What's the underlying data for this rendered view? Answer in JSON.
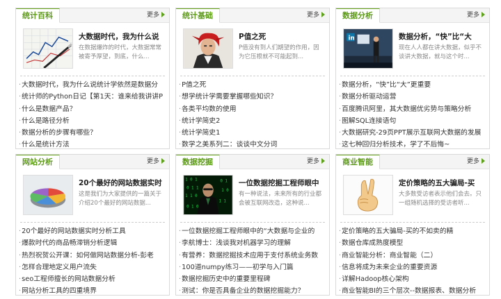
{
  "panels": [
    {
      "tab": "统计百科",
      "more": "更多",
      "feature": {
        "title": "大数据时代，我为什么说",
        "desc": "在数据爆炸的时代，大数据常常被寄予厚望，到底，什么..."
      },
      "links": [
        "大数据时代，我为什么说统计学依然是数据分",
        "统计师的Python日记【第1天：谁来给我讲讲P",
        "什么是数据产品？",
        "什么是路径分析",
        "数据分析的步骤有哪些？",
        "什么是统计方法"
      ]
    },
    {
      "tab": "统计基础",
      "more": "更多",
      "feature": {
        "title": "P值之死",
        "desc": "P值没有到人们期望的作用，因为它压根就不可能起到..."
      },
      "links": [
        "P值之死",
        "想学统计学需要掌握哪些知识？",
        "各类平均数的使用",
        "统计学简史2",
        "统计学简史1",
        "数学之美系列二：谈谈中文分词"
      ]
    },
    {
      "tab": "数据分析",
      "more": "更多",
      "feature": {
        "title": "数据分析，“快”比“大",
        "desc": "现在人人都在讲大数据，似乎不谈讲大数据，就与这个时..."
      },
      "links": [
        "数据分析，“快”比“大”更重要",
        "数据分析驱动运营",
        "百度腾讯阿里，其大数据优劣势与策略分析",
        "图解SQL连接语句",
        "大数据研究-29页PPT展示互联网大数据的发展",
        "这七种回归分析技术，学了不后悔~"
      ]
    },
    {
      "tab": "网站分析",
      "more": "更多",
      "feature": {
        "title": "20个最好的网站数据实时",
        "desc": "这是我们为大家提供的一篇关于介绍20个最好的网站数据..."
      },
      "links": [
        "20个最好的网站数据实时分析工具",
        "爆款时代的商品畅滞销分析逻辑",
        "热烈祝贺公开课：如何做网站数据分析-彭老",
        "怎样合理地定义用户流失",
        "seo工程师擅长的网站数据分析",
        "网站分析工具的四重境界"
      ]
    },
    {
      "tab": "数据挖掘",
      "more": "更多",
      "feature": {
        "title": "一位数据挖掘工程师眼中",
        "desc": "有一种说法，未来所有的行业都会被互联网改造，这种说..."
      },
      "links": [
        "一位数据挖掘工程师眼中的“大数据与企业的",
        "李航博士：浅谈我对机器学习的理解",
        "有营养：数据挖掘技术应用于支付系统业务数",
        "100道numpy练习——初学与入门篇",
        "数据挖掘历史中的重要里程碑",
        "测试：你是否具备企业的数据挖掘能力？"
      ]
    },
    {
      "tab": "商业智能",
      "more": "更多",
      "feature": {
        "title": "定价策略的五大骗局-买",
        "desc": "大多数受访者表示他们会去。只一组随机选择的受访者听..."
      },
      "links": [
        "定价策略的五大骗局-买的不如卖的精",
        "数据仓库成熟度模型",
        "商业智能分析：商业智能（二）",
        "信息将成为未来企业的重要资源",
        "详解Hadoop核心架构",
        "商业智能BI的三个层次--数据报表、数据分析"
      ]
    }
  ],
  "thumbnails": [
    "chart-paper-with-pen-thumbnail",
    "red-hair-warrior-thumbnail",
    "speaker-on-stage-linkedin-thumbnail",
    "3d-pie-chart-thumbnail",
    "matrix-man-thumbnail",
    "victory-hand-thumbnail"
  ]
}
